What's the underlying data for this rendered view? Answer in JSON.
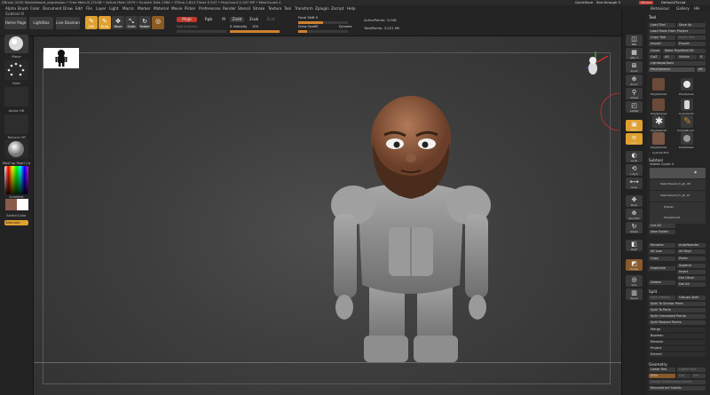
{
  "titlebar": {
    "text": "ZBrush 2020  Sketchbeard_expression  • Free Mem 8.171GB • Active Mem 1979 • Scratch Disk 1384 • ZTime 1.614 Timer 0.347 • PolyCount 4.197 MP • MeshCount 4",
    "quicksave": "QuickSave",
    "see_through": "See-through  0",
    "menus_btn": "Menus",
    "default_script": "DefaultZScript"
  },
  "menu": [
    "Alpha",
    "Brush",
    "Color",
    "Document",
    "Draw",
    "Edit",
    "File",
    "Layer",
    "Light",
    "Macro",
    "Marker",
    "Material",
    "Movie",
    "Picker",
    "Preferences",
    "Render",
    "Stencil",
    "Stroke",
    "Texture",
    "Tool",
    "Transform",
    "Zplugin",
    "Zscript",
    "Help"
  ],
  "menu_right": [
    "Behaviour",
    "Gallery",
    "HH"
  ],
  "subtool_title": "Subtool 8",
  "shelf": {
    "home_page": "Home Page",
    "lightbox": "LightBox",
    "live_boolean": "Live Boolean",
    "modes": [
      {
        "glyph": "✎",
        "label": "Edit",
        "on": true
      },
      {
        "glyph": "✎",
        "label": "Draw",
        "on": true
      },
      {
        "glyph": "✥",
        "label": "Move",
        "on": false
      },
      {
        "glyph": "⤡",
        "label": "Scale",
        "on": false
      },
      {
        "glyph": "↻",
        "label": "Rotate",
        "on": false
      },
      {
        "glyph": "◎",
        "label": "",
        "on": false
      }
    ],
    "mrgb": "Mrgb",
    "rgb": "Rgb",
    "m": "M",
    "zadd": "Zadd",
    "zsub": "Zsub",
    "zcut": "Zcut",
    "rgb_intensity_label": "Rgb Intensity",
    "z_intensity_label": "Z Intensity",
    "z_intensity_value": "100",
    "focal_shift_label": "Focal Shift",
    "focal_shift_value": "0",
    "draw_size_label": "Draw Size",
    "draw_size_value": "65",
    "dynamic": "Dynamic",
    "active_points": "ActivePoints: 3,048",
    "total_points": "TotalPoints: 3,021 Mil"
  },
  "left_tray": {
    "brush_label": "Move",
    "stroke_label": "Dots",
    "alpha_label": "Alpha Off",
    "texture_label": "Texture Off",
    "material_label": "MatCap Pearl Ca",
    "gradient_label": "Gradient",
    "switch_label": "SwitchColor",
    "alternate_label": "Alternate"
  },
  "right_shelf": [
    {
      "glyph": "◫",
      "label": "BPR"
    },
    {
      "glyph": "▦",
      "label": "SPix 3"
    },
    {
      "glyph": "⊞",
      "label": "Scroll"
    },
    {
      "glyph": "⊕",
      "label": "Zoom"
    },
    {
      "glyph": "⚲",
      "label": "Actual"
    },
    {
      "glyph": "◰",
      "label": "AAHalf"
    },
    {
      "glyph": "▣",
      "label": "Persp"
    },
    {
      "glyph": "≡",
      "label": "Floor"
    },
    {
      "glyph": "◐",
      "label": "Local"
    },
    {
      "glyph": "⟲",
      "label": "L.Sym"
    },
    {
      "glyph": "⟷",
      "label": "Gxyz"
    },
    {
      "glyph": "✥",
      "label": "Move"
    },
    {
      "glyph": "⊕",
      "label": "Zoom3D"
    },
    {
      "glyph": "↻",
      "label": "Rotate"
    },
    {
      "glyph": "◧",
      "label": "PolyF"
    },
    {
      "glyph": "◩",
      "label": "Transp"
    },
    {
      "glyph": "◎",
      "label": "Solo"
    },
    {
      "glyph": "▥",
      "label": "Xpose"
    }
  ],
  "tool_panel": {
    "title": "Tool",
    "load_tool": "Load Tool",
    "save_as": "Save As",
    "load_tools_from_project": "Load Tools From Project",
    "copy_tool": "Copy Tool",
    "paste_tool": "Paste Tool",
    "import": "Import",
    "export": "Export",
    "clone": "Clone",
    "make_polymesh": "Make PolyMesh3D",
    "goz": "GoZ",
    "all": "All",
    "visible": "Visible",
    "r": "R",
    "lightbox_tools": "Lightbox▸Tools",
    "polysphere_label": "PolySphere1.",
    "polysphere_value": "49",
    "tools": [
      {
        "label": "PolySphere1",
        "color": "#6b4a3a"
      },
      {
        "label": "PolySphere",
        "color": "#e8e8e8"
      },
      {
        "label": "PolySphere1",
        "color": "#6b4a3a"
      },
      {
        "label": "Cylinder3D",
        "color": "#d8d8d8"
      },
      {
        "label": "PolyMesh3D",
        "color": "#e8e8e8"
      },
      {
        "label": "SimpleBrush",
        "color": "#c88a2a"
      },
      {
        "label": "PolySphere1",
        "color": "#7a5646"
      },
      {
        "label": "DoMeHead",
        "color": "#999999"
      },
      {
        "label": "Cylinder3D1",
        "color": "#e0e0e0"
      }
    ],
    "subtool_header": "Subtool",
    "visible_count": "Visible Count 4",
    "subtools": [
      {
        "name": "",
        "selected": true
      },
      {
        "name": "Sketchbeard_hi_gh_08",
        "selected": false
      },
      {
        "name": "Sketchbeard_hi_gh_07",
        "selected": false
      },
      {
        "name": "Eyehair",
        "selected": false
      },
      {
        "name": "PolySphere1",
        "selected": false
      }
    ],
    "list_all": "List All",
    "new_folder": "New Folder",
    "rename": "Rename",
    "auto_reorder": "AutoReorder",
    "all_low": "All Low",
    "all_high": "All High",
    "copy": "Copy",
    "paste": "Paste",
    "duplicate": "Duplicate",
    "append": "Append",
    "insert": "Insert",
    "del_other": "Del Other",
    "delete": "Delete",
    "del_all": "Del All",
    "split_header": "Split",
    "split_hidden": "Split Hidden",
    "groups_split": "Groups Split",
    "split_similar": "Split To Similar Parts",
    "split_parts": "Split To Parts",
    "split_unmasked": "Split Unmasked Points",
    "split_masked": "Split Masked Points",
    "merge": "Merge",
    "boolean": "Boolean",
    "remesh": "Remesh",
    "project": "Project",
    "extract": "Extract",
    "geometry": "Geometry",
    "lower_res": "Lower Res",
    "higher_res": "Higher Res",
    "sdiv": "SDiv",
    "del_lower": "Del Lower",
    "del_higher": "Del Higher",
    "freeze_subdivision": "Freeze SubDivision Levels",
    "reconstruct_subdiv": "Reconstruct Subdiv"
  }
}
